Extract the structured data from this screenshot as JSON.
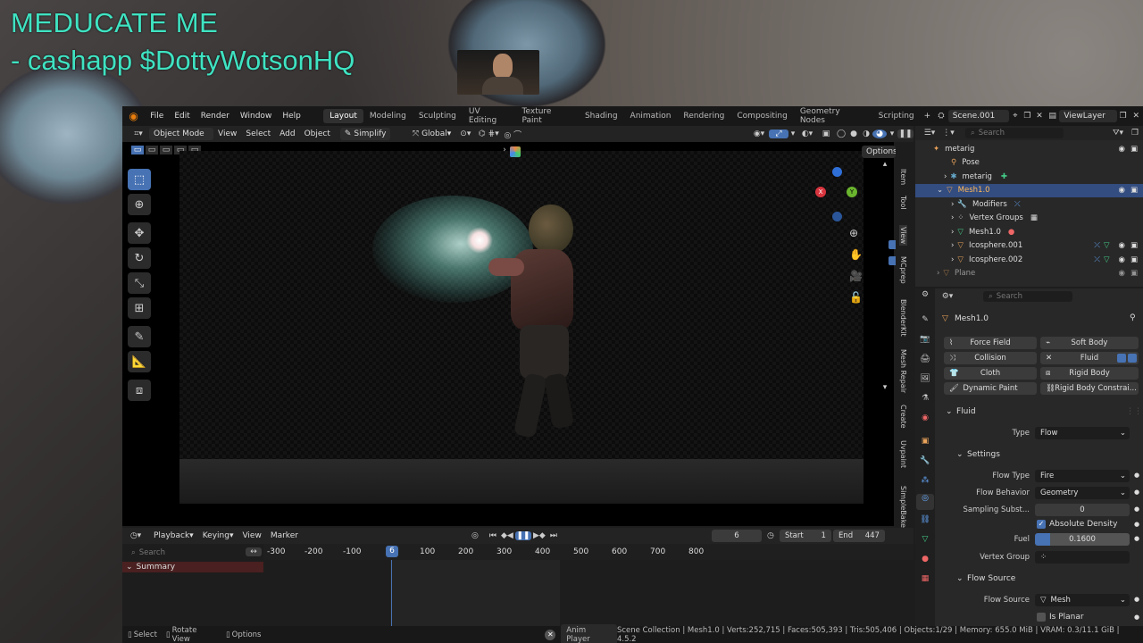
{
  "stream": {
    "overlay_line1": "MEDUCATE ME",
    "overlay_line2": "- cashapp $DottyWotsonHQ"
  },
  "menu": [
    "File",
    "Edit",
    "Render",
    "Window",
    "Help"
  ],
  "workspaces": [
    "Layout",
    "Modeling",
    "Sculpting",
    "UV Editing",
    "Texture Paint",
    "Shading",
    "Animation",
    "Rendering",
    "Compositing",
    "Geometry Nodes",
    "Scripting"
  ],
  "scene": {
    "name": "Scene.001",
    "view_layer": "ViewLayer"
  },
  "viewport_header": {
    "mode": "Object Mode",
    "items": [
      "View",
      "Select",
      "Add",
      "Object"
    ],
    "simplify": "Simplify",
    "transform": "Global",
    "options": "Options"
  },
  "side_tabs": [
    "Item",
    "Tool",
    "View",
    "MCprep",
    "BlenderKit",
    "Mesh Repair",
    "Create",
    "Uvpaint",
    "SimpleBake"
  ],
  "outliner": {
    "search_placeholder": "Search",
    "rows": [
      {
        "label": "metarig",
        "indent": 1
      },
      {
        "label": "Pose",
        "indent": 2
      },
      {
        "label": "metarig",
        "indent": 2
      },
      {
        "label": "Mesh1.0",
        "indent": 1,
        "selected": true
      },
      {
        "label": "Modifiers",
        "indent": 2
      },
      {
        "label": "Vertex Groups",
        "indent": 2
      },
      {
        "label": "Mesh1.0",
        "indent": 2
      },
      {
        "label": "Icosphere.001",
        "indent": 2
      },
      {
        "label": "Icosphere.002",
        "indent": 2
      },
      {
        "label": "Plane",
        "indent": 1
      }
    ]
  },
  "properties": {
    "search_placeholder": "Search",
    "object": "Mesh1.0",
    "physics_buttons": [
      "Force Field",
      "Soft Body",
      "Collision",
      "Fluid",
      "Cloth",
      "Rigid Body",
      "Dynamic Paint",
      "Rigid Body Constrai..."
    ],
    "fluid_panel": "Fluid",
    "type_label": "Type",
    "type_value": "Flow",
    "settings_panel": "Settings",
    "flow_type_label": "Flow Type",
    "flow_type_value": "Fire",
    "flow_behavior_label": "Flow Behavior",
    "flow_behavior_value": "Geometry",
    "sampling_label": "Sampling Subst...",
    "sampling_value": "0",
    "absolute_density": "Absolute Density",
    "fuel_label": "Fuel",
    "fuel_value": "0.1600",
    "vertex_group_label": "Vertex Group",
    "flow_source_panel": "Flow Source",
    "flow_source_label": "Flow Source",
    "flow_source_value": "Mesh",
    "is_planar": "Is Planar"
  },
  "timeline": {
    "menus": [
      "Playback",
      "Keying",
      "View",
      "Marker"
    ],
    "current_frame": "6",
    "start_label": "Start",
    "start_value": "1",
    "end_label": "End",
    "end_value": "447",
    "search_placeholder": "Search",
    "summary": "Summary",
    "ticks": [
      "-300",
      "-200",
      "-100",
      "6",
      "100",
      "200",
      "300",
      "400",
      "500",
      "600",
      "700",
      "800"
    ]
  },
  "statusbar": {
    "select": "Select",
    "rotate": "Rotate View",
    "options": "Options",
    "anim": "Anim Player",
    "stats": "Scene Collection | Mesh1.0 | Verts:252,715 | Faces:505,393 | Tris:505,406 | Objects:1/29 | Memory: 655.0 MiB | VRAM: 0.3/11.1 GiB | 4.5.2"
  },
  "colors": {
    "accent": "#4772b3",
    "overlay_text": "#3fe3c2",
    "selected_row": "#334d80"
  }
}
